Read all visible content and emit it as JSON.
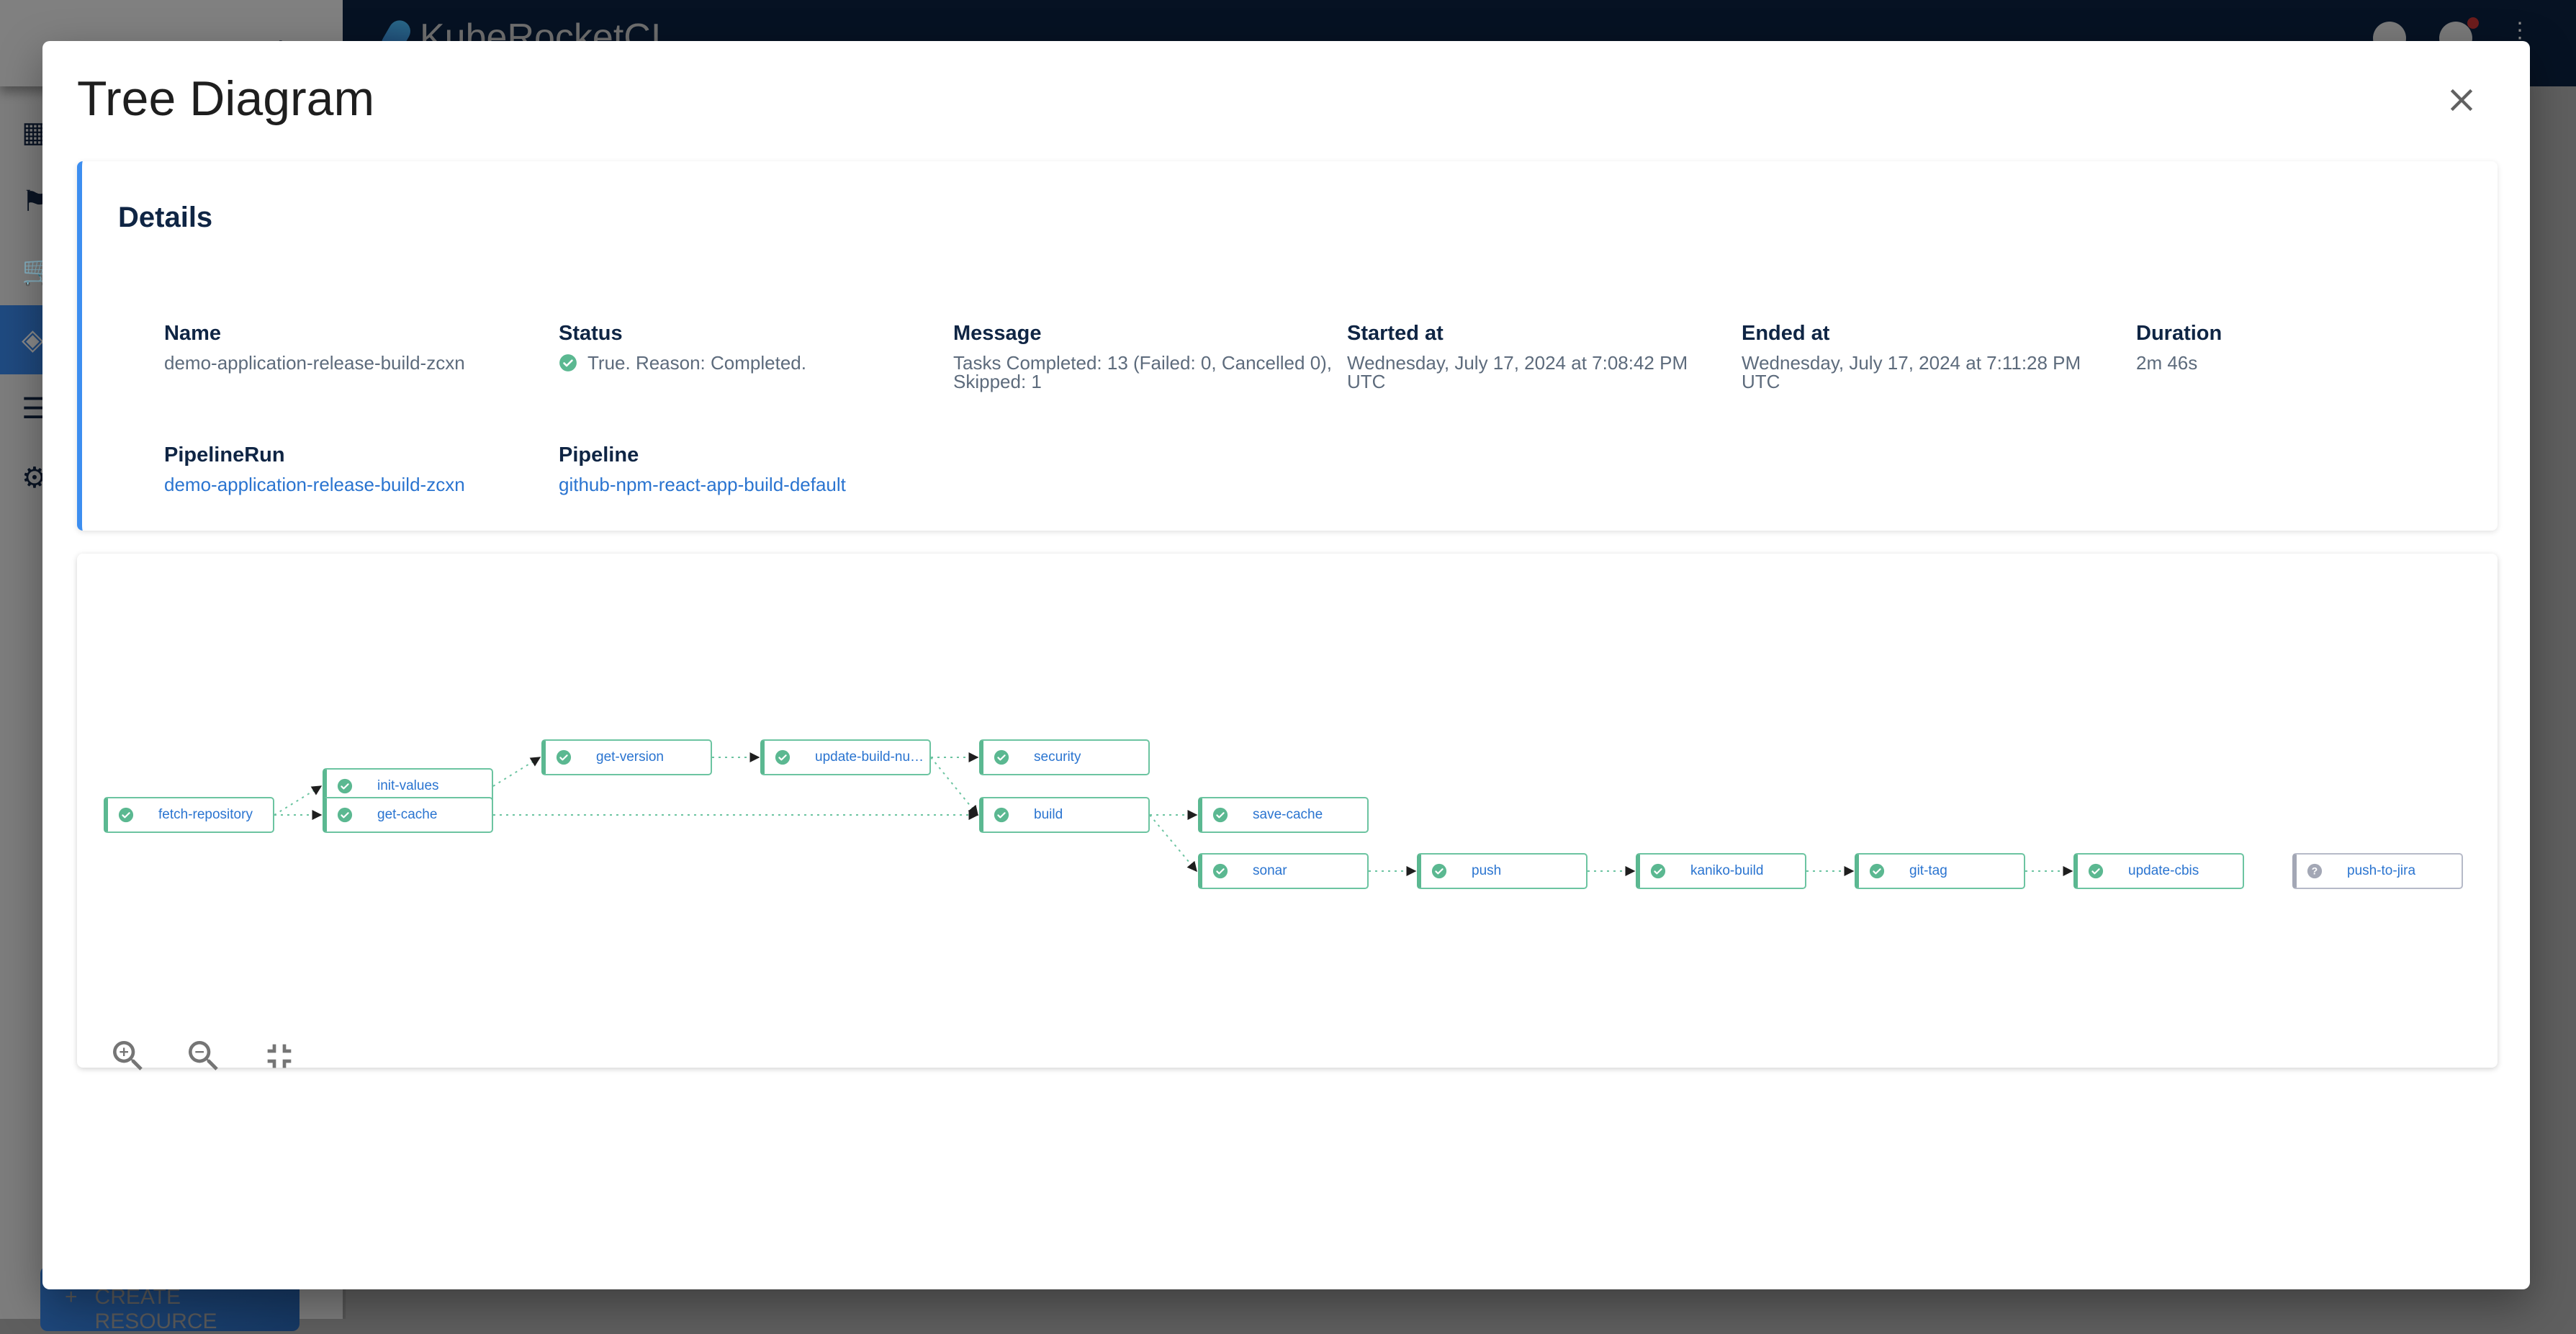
{
  "background_app": {
    "app_name": "KubeRocketCI",
    "create_button_label": "CREATE RESOURCE",
    "sidebar_icons": [
      "dashboard-icon",
      "flag-icon",
      "cart-icon",
      "layers-icon",
      "storage-icon",
      "settings-icon"
    ],
    "active_sidebar_index": 3
  },
  "modal": {
    "title": "Tree Diagram",
    "close_icon": "close-icon"
  },
  "details": {
    "heading": "Details",
    "fields": {
      "name": {
        "label": "Name",
        "value": "demo-application-release-build-zcxn"
      },
      "status": {
        "label": "Status",
        "value": "True. Reason: Completed.",
        "icon": "check-circle-icon"
      },
      "message": {
        "label": "Message",
        "value_line1": "Tasks Completed: 13 (Failed: 0, Cancelled 0),",
        "value_line2": "Skipped: 1"
      },
      "started_at": {
        "label": "Started at",
        "value_line1": "Wednesday, July 17, 2024 at 7:08:42 PM",
        "value_line2": "UTC"
      },
      "ended_at": {
        "label": "Ended at",
        "value_line1": "Wednesday, July 17, 2024 at 7:11:28 PM",
        "value_line2": "UTC"
      },
      "duration": {
        "label": "Duration",
        "value": "2m 46s"
      },
      "pipelinerun": {
        "label": "PipelineRun",
        "value": "demo-application-release-build-zcxn"
      },
      "pipeline": {
        "label": "Pipeline",
        "value": "github-npm-react-app-build-default"
      }
    }
  },
  "colors": {
    "accent": "#3d8ef0",
    "success": "#5bb891",
    "unknown": "#a3a7b5",
    "link": "#2a74d0",
    "heading": "#0f2544"
  },
  "graph": {
    "nodes": [
      {
        "id": "fetch-repository",
        "label": "fetch-repository",
        "status": "succeeded"
      },
      {
        "id": "init-values",
        "label": "init-values",
        "status": "succeeded"
      },
      {
        "id": "get-version",
        "label": "get-version",
        "status": "succeeded"
      },
      {
        "id": "get-cache",
        "label": "get-cache",
        "status": "succeeded"
      },
      {
        "id": "update-build-number",
        "label": "update-build-num...",
        "status": "succeeded"
      },
      {
        "id": "security",
        "label": "security",
        "status": "succeeded"
      },
      {
        "id": "build",
        "label": "build",
        "status": "succeeded"
      },
      {
        "id": "save-cache",
        "label": "save-cache",
        "status": "succeeded"
      },
      {
        "id": "sonar",
        "label": "sonar",
        "status": "succeeded"
      },
      {
        "id": "push",
        "label": "push",
        "status": "succeeded"
      },
      {
        "id": "kaniko-build",
        "label": "kaniko-build",
        "status": "succeeded"
      },
      {
        "id": "git-tag",
        "label": "git-tag",
        "status": "succeeded"
      },
      {
        "id": "update-cbis",
        "label": "update-cbis",
        "status": "succeeded"
      },
      {
        "id": "push-to-jira",
        "label": "push-to-jira",
        "status": "unknown"
      }
    ],
    "edges": [
      [
        "fetch-repository",
        "init-values"
      ],
      [
        "fetch-repository",
        "get-cache"
      ],
      [
        "init-values",
        "get-version"
      ],
      [
        "get-version",
        "update-build-number"
      ],
      [
        "update-build-number",
        "security"
      ],
      [
        "update-build-number",
        "build"
      ],
      [
        "get-cache",
        "build"
      ],
      [
        "build",
        "save-cache"
      ],
      [
        "build",
        "sonar"
      ],
      [
        "sonar",
        "push"
      ],
      [
        "push",
        "kaniko-build"
      ],
      [
        "kaniko-build",
        "git-tag"
      ],
      [
        "git-tag",
        "update-cbis"
      ]
    ],
    "controls": [
      {
        "id": "zoom-in",
        "icon": "zoom-in-icon"
      },
      {
        "id": "zoom-out",
        "icon": "zoom-out-icon"
      },
      {
        "id": "fit",
        "icon": "fit-to-screen-icon"
      }
    ]
  }
}
